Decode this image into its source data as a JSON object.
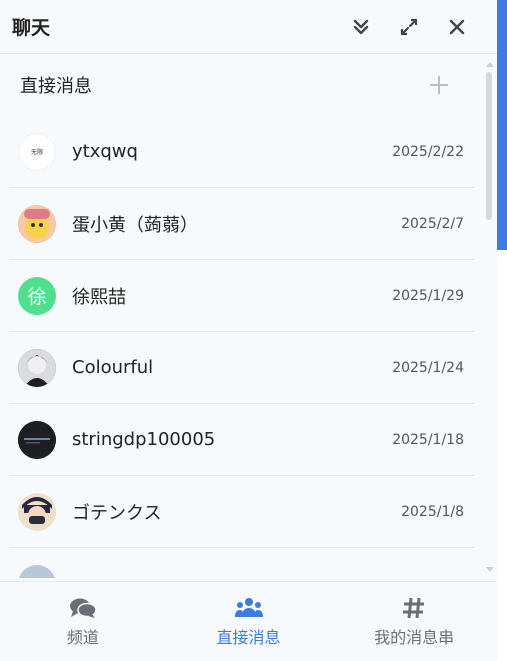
{
  "header": {
    "title": "聊天",
    "collapse_icon": "double-chevron-down-icon",
    "expand_icon": "expand-icon",
    "close_icon": "close-icon"
  },
  "section": {
    "title": "直接消息",
    "add_icon": "plus-icon"
  },
  "conversations": [
    {
      "name": "ytxqwq",
      "date": "2025/2/22",
      "avatar_text": "无限",
      "avatar_bg": "#ffffff",
      "avatar_fg": "#333333"
    },
    {
      "name": "蛋小黄（蒟蒻）",
      "date": "2025/2/7",
      "avatar_text": "",
      "avatar_bg": "#f2b48a",
      "avatar_fg": "#ffffff"
    },
    {
      "name": "徐熙喆",
      "date": "2025/1/29",
      "avatar_text": "徐",
      "avatar_bg": "#4ee08e",
      "avatar_fg": "#ffffff"
    },
    {
      "name": "Colourful",
      "date": "2025/1/24",
      "avatar_text": "",
      "avatar_bg": "#2a2a30",
      "avatar_fg": "#ffffff"
    },
    {
      "name": "stringdp100005",
      "date": "2025/1/18",
      "avatar_text": "",
      "avatar_bg": "#1e1f22",
      "avatar_fg": "#9ad"
    },
    {
      "name": "ゴテンクス",
      "date": "2025/1/8",
      "avatar_text": "",
      "avatar_bg": "#e8d3b8",
      "avatar_fg": "#222"
    },
    {
      "name": "",
      "date": "",
      "avatar_text": "",
      "avatar_bg": "#b8c8d8",
      "avatar_fg": "#222"
    }
  ],
  "bottom_nav": [
    {
      "label": "频道",
      "icon": "chat-bubbles-icon",
      "active": false
    },
    {
      "label": "直接消息",
      "icon": "users-icon",
      "active": true
    },
    {
      "label": "我的消息串",
      "icon": "hashtag-icon",
      "active": false
    }
  ],
  "colors": {
    "accent": "#3d7bdc",
    "inactive": "#6b6f75",
    "background": "#f7fafd"
  }
}
